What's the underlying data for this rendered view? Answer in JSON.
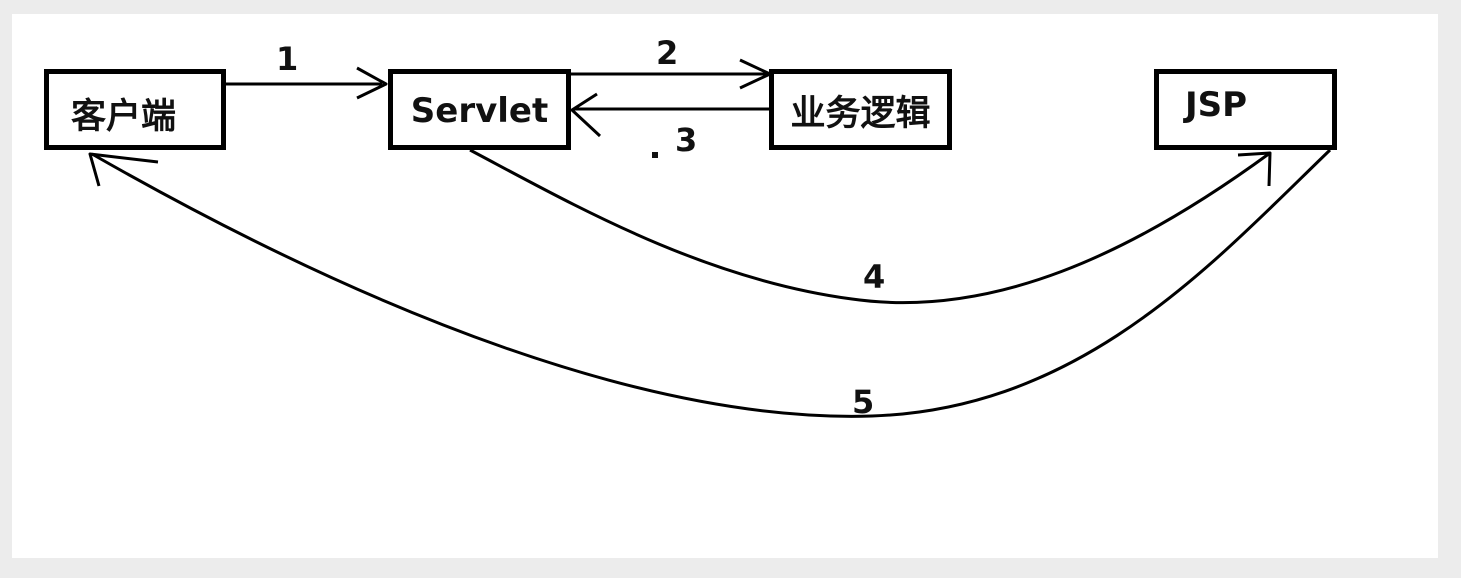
{
  "diagram": {
    "nodes": {
      "client": "客户端",
      "servlet": "Servlet",
      "logic": "业务逻辑",
      "jsp": "JSP"
    },
    "edges": [
      {
        "id": "1",
        "from": "客户端",
        "to": "Servlet",
        "label": "1"
      },
      {
        "id": "2",
        "from": "Servlet",
        "to": "业务逻辑",
        "label": "2"
      },
      {
        "id": "3",
        "from": "业务逻辑",
        "to": "Servlet",
        "label": "3"
      },
      {
        "id": "4",
        "from": "Servlet",
        "to": "JSP",
        "label": "4"
      },
      {
        "id": "5",
        "from": "JSP",
        "to": "客户端",
        "label": "5"
      }
    ]
  },
  "colors": {
    "stroke": "#000000",
    "background": "#ffffff",
    "frame": "#ececec"
  }
}
